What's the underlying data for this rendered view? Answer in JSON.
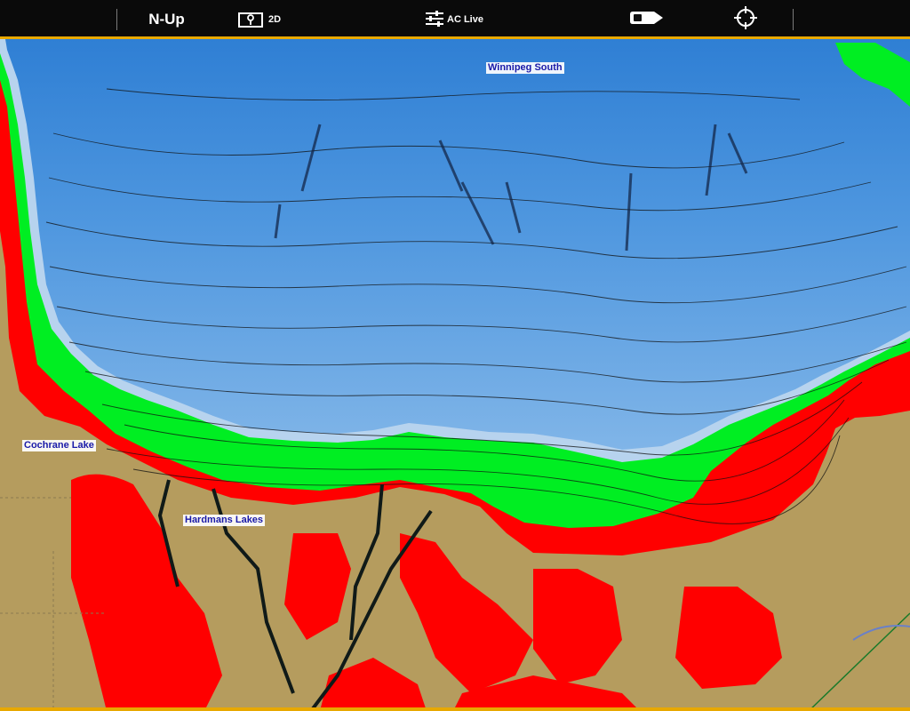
{
  "toolbar": {
    "orientation_label": "N-Up",
    "view_label": "2D",
    "autochart_label": "AC Live",
    "icons": {
      "view": "map-pin-icon",
      "autochart": "sliders-icon",
      "boat": "boat-icon",
      "target": "crosshair-icon"
    },
    "accent_color": "#e8a800"
  },
  "map": {
    "labels": {
      "winnipeg": "Winnipeg  South",
      "cochrane": "Cochrane Lake",
      "hardmans": "Hardmans  Lakes"
    },
    "colors": {
      "land": "#b59c5e",
      "shallow": "#ff0000",
      "mid_shallow": "#00ee22",
      "deep_light": "#8ab8e8",
      "deep_mid": "#5a9de0",
      "deep": "#2f80d6",
      "contour": "#101010"
    }
  }
}
